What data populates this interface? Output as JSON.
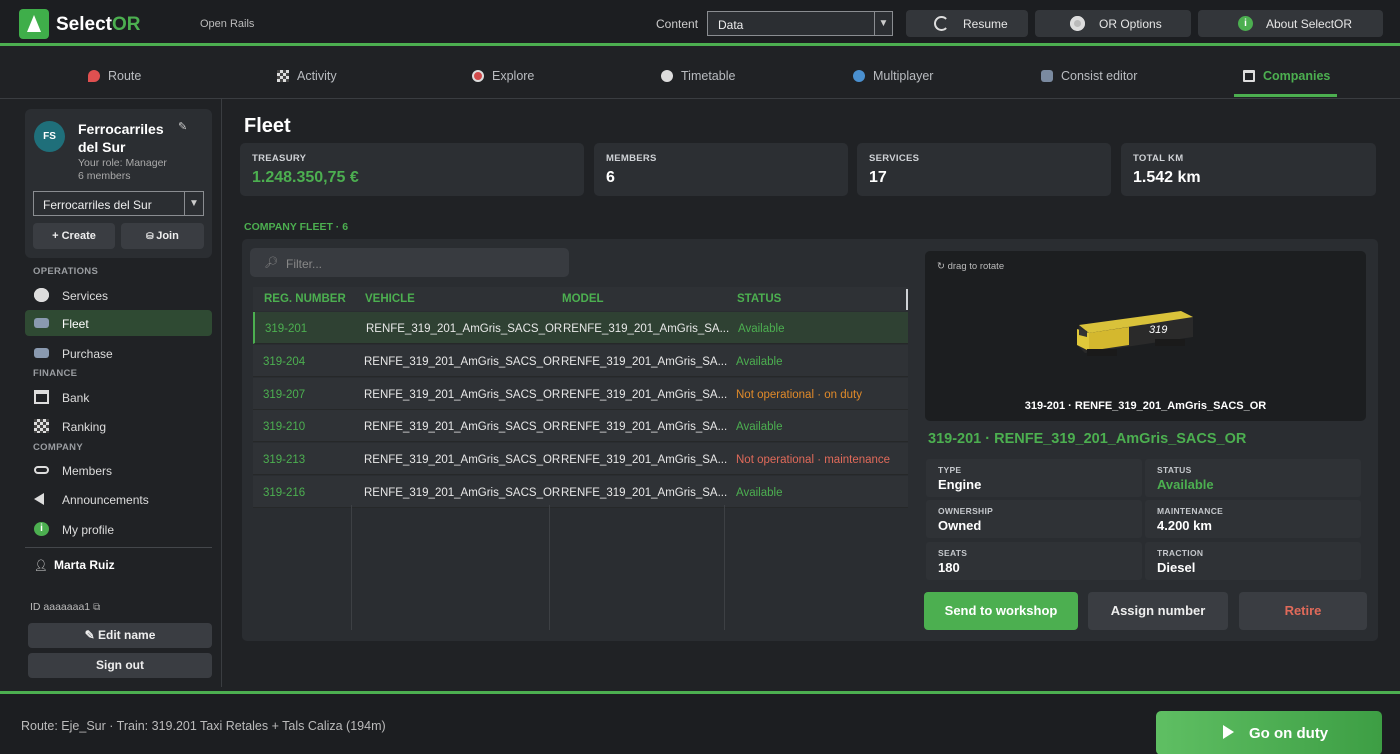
{
  "header": {
    "app_name_a": "Select",
    "app_name_b": "OR",
    "subtitle": "Open Rails",
    "content_label": "Content",
    "content_value": "Data",
    "buttons": [
      {
        "label": "Resume",
        "icon": "resume-icon"
      },
      {
        "label": "OR Options",
        "icon": "disc-icon"
      },
      {
        "label": "About SelectOR",
        "icon": "info-icon"
      }
    ]
  },
  "tabs": [
    {
      "label": "Route",
      "icon": "map-pin-icon"
    },
    {
      "label": "Activity",
      "icon": "checkered-flag-icon"
    },
    {
      "label": "Explore",
      "icon": "compass-icon"
    },
    {
      "label": "Timetable",
      "icon": "clock-icon"
    },
    {
      "label": "Multiplayer",
      "icon": "globe-icon"
    },
    {
      "label": "Consist editor",
      "icon": "train-icon"
    },
    {
      "label": "Companies",
      "icon": "building-icon",
      "active": true
    }
  ],
  "sidebar": {
    "company_initials": "FS",
    "company_name": "Ferrocarriles del Sur",
    "role": "Your role: Manager",
    "members": "6 members",
    "company_select": "Ferrocarriles del Sur",
    "create_label": "+ Create",
    "join_label": "Join",
    "sections": {
      "operations": "OPERATIONS",
      "finance": "FINANCE",
      "company": "COMPANY"
    },
    "items": [
      {
        "label": "Services",
        "icon": "clock-icon"
      },
      {
        "label": "Fleet",
        "icon": "train-icon",
        "active": true
      },
      {
        "label": "Purchase",
        "icon": "train-icon"
      },
      {
        "label": "Bank",
        "icon": "bank-icon"
      },
      {
        "label": "Ranking",
        "icon": "checkered-flag-icon"
      },
      {
        "label": "Members",
        "icon": "link-icon"
      },
      {
        "label": "Announcements",
        "icon": "speaker-icon"
      },
      {
        "label": "My profile",
        "icon": "info-icon"
      }
    ],
    "user_name": "Marta Ruiz",
    "user_id": "ID aaaaaaa1",
    "edit_name": "Edit name",
    "sign_out": "Sign out"
  },
  "main": {
    "title": "Fleet",
    "stats": [
      {
        "label": "TREASURY",
        "value": "1.248.350,75 €",
        "green": true
      },
      {
        "label": "MEMBERS",
        "value": "6"
      },
      {
        "label": "SERVICES",
        "value": "17"
      },
      {
        "label": "TOTAL KM",
        "value": "1.542 km"
      }
    ],
    "fleet_label": "COMPANY FLEET · 6",
    "filter_placeholder": "Filter...",
    "columns": [
      "REG. NUMBER",
      "VEHICLE",
      "MODEL",
      "STATUS"
    ],
    "rows": [
      {
        "reg": "319-201",
        "vehicle": "RENFE_319_201_AmGris_SACS_OR",
        "model": "RENFE_319_201_AmGris_SA...",
        "status": "Available",
        "kind": "ok"
      },
      {
        "reg": "319-204",
        "vehicle": "RENFE_319_201_AmGris_SACS_OR",
        "model": "RENFE_319_201_AmGris_SA...",
        "status": "Available",
        "kind": "ok"
      },
      {
        "reg": "319-207",
        "vehicle": "RENFE_319_201_AmGris_SACS_OR",
        "model": "RENFE_319_201_AmGris_SA...",
        "status": "Not operational · on duty",
        "kind": "warn"
      },
      {
        "reg": "319-210",
        "vehicle": "RENFE_319_201_AmGris_SACS_OR",
        "model": "RENFE_319_201_AmGris_SA...",
        "status": "Available",
        "kind": "ok"
      },
      {
        "reg": "319-213",
        "vehicle": "RENFE_319_201_AmGris_SACS_OR",
        "model": "RENFE_319_201_AmGris_SA...",
        "status": "Not operational · maintenance",
        "kind": "bad"
      },
      {
        "reg": "319-216",
        "vehicle": "RENFE_319_201_AmGris_SACS_OR",
        "model": "RENFE_319_201_AmGris_SA...",
        "status": "Available",
        "kind": "ok"
      }
    ],
    "preview_hint": "↻ drag to rotate",
    "preview_caption": "319-201  ·  RENFE_319_201_AmGris_SACS_OR",
    "loco_number": "319",
    "detail_title": "319-201  ·  RENFE_319_201_AmGris_SACS_OR",
    "details": [
      {
        "label": "TYPE",
        "value": "Engine"
      },
      {
        "label": "STATUS",
        "value": "Available",
        "green": true
      },
      {
        "label": "OWNERSHIP",
        "value": "Owned"
      },
      {
        "label": "MAINTENANCE",
        "value": "4.200 km"
      },
      {
        "label": "SEATS",
        "value": "180"
      },
      {
        "label": "TRACTION",
        "value": "Diesel"
      }
    ],
    "actions": {
      "workshop": "Send to workshop",
      "assign": "Assign number",
      "retire": "Retire"
    }
  },
  "footer": {
    "status": "Route: Eje_Sur  ·  Train: 319.201 Taxi Retales + Tals Caliza (194m)",
    "go_label": "Go on duty"
  },
  "colors": {
    "accent": "#4caf50",
    "warning": "#e08a2a",
    "danger": "#e06a5a",
    "background": "#202225"
  }
}
